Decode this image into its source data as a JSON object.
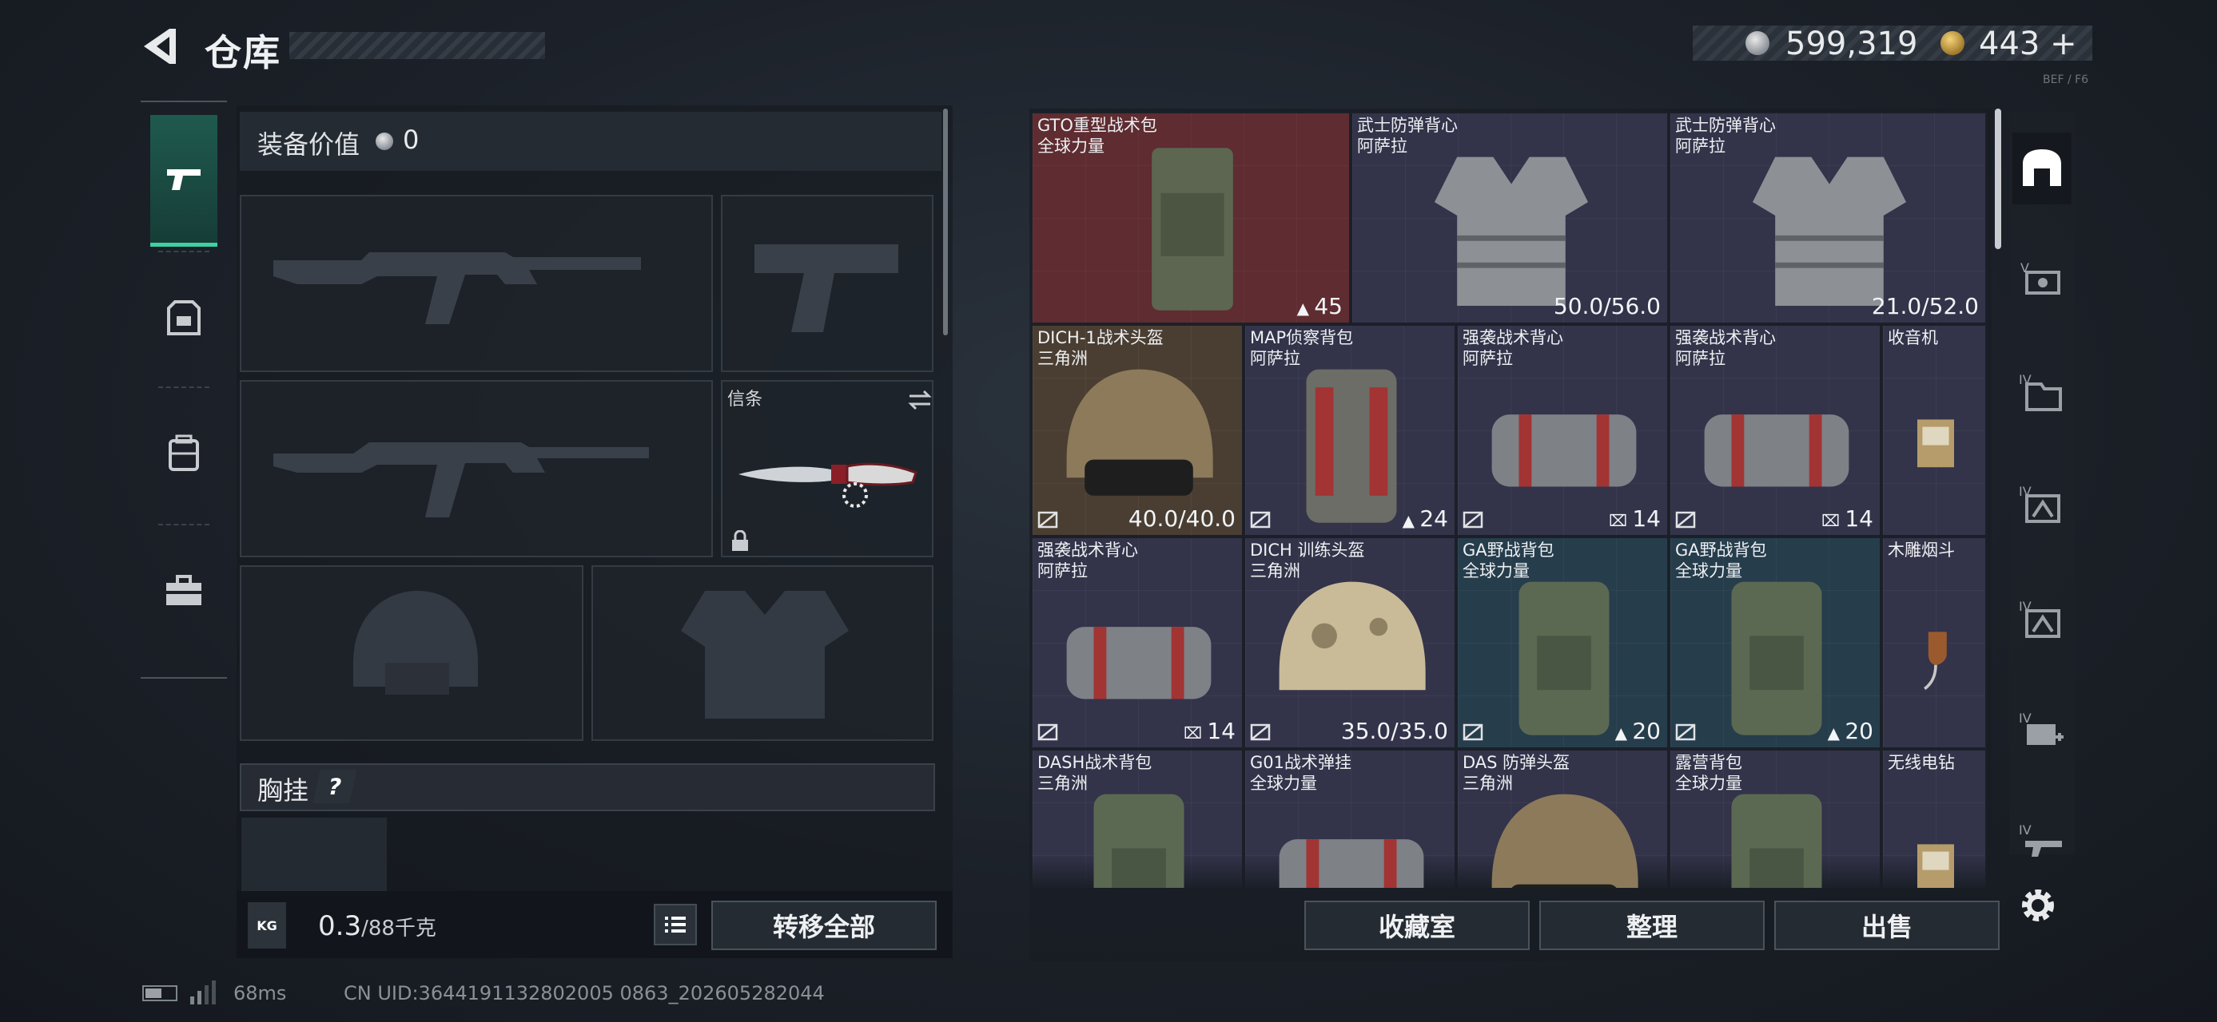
{
  "header": {
    "title": "仓库",
    "currency_silver": "599,319",
    "currency_gold": "443",
    "add_symbol": "+",
    "corner_label": "BEF / F6"
  },
  "loadout": {
    "equip_value_label": "装备价值",
    "equip_value": "0",
    "knife_label": "信条",
    "chest_label": "胸挂",
    "chest_help": "?",
    "weight_current": "0.3",
    "weight_max": "/88千克",
    "weight_icon_text": "KG",
    "transfer_all": "转移全部"
  },
  "left_rail": [
    "pistol-icon",
    "armor-icon",
    "backpack-icon",
    "toolbox-icon"
  ],
  "stash": {
    "items": [
      {
        "name": "GTO重型战术包",
        "sub": "全球力量",
        "stat": "45",
        "stat_icon": "bag",
        "rarity": "red"
      },
      {
        "name": "武士防弹背心",
        "sub": "阿萨拉",
        "stat": "50.0/56.0",
        "rarity": "purple"
      },
      {
        "name": "武士防弹背心",
        "sub": "阿萨拉",
        "stat": "21.0/52.0",
        "rarity": "purple"
      },
      {
        "name": "DICH-1战术头盔",
        "sub": "三角洲",
        "stat": "40.0/40.0",
        "rarity": "gold",
        "nobind": true
      },
      {
        "name": "MAP侦察背包",
        "sub": "阿萨拉",
        "stat": "24",
        "stat_icon": "bag",
        "rarity": "purple",
        "nobind": true
      },
      {
        "name": "强袭战术背心",
        "sub": "阿萨拉",
        "stat": "14",
        "stat_icon": "vest",
        "rarity": "purple",
        "nobind": true
      },
      {
        "name": "强袭战术背心",
        "sub": "阿萨拉",
        "stat": "14",
        "stat_icon": "vest",
        "rarity": "purple",
        "nobind": true
      },
      {
        "name": "收音机",
        "sub": "",
        "stat": "",
        "rarity": "purple"
      },
      {
        "name": "强袭战术背心",
        "sub": "阿萨拉",
        "stat": "14",
        "stat_icon": "vest",
        "rarity": "purple",
        "nobind": true
      },
      {
        "name": "DICH 训练头盔",
        "sub": "三角洲",
        "stat": "35.0/35.0",
        "rarity": "purple",
        "nobind": true
      },
      {
        "name": "GA野战背包",
        "sub": "全球力量",
        "stat": "20",
        "stat_icon": "bag",
        "rarity": "blue",
        "nobind": true
      },
      {
        "name": "GA野战背包",
        "sub": "全球力量",
        "stat": "20",
        "stat_icon": "bag",
        "rarity": "blue",
        "nobind": true
      },
      {
        "name": "木雕烟斗",
        "sub": "",
        "stat": "",
        "rarity": "purple"
      },
      {
        "name": "DASH战术背包",
        "sub": "三角洲",
        "stat": "",
        "rarity": "purple"
      },
      {
        "name": "G01战术弹挂",
        "sub": "全球力量",
        "stat": "",
        "rarity": "purple"
      },
      {
        "name": "DAS 防弹头盔",
        "sub": "三角洲",
        "stat": "",
        "rarity": "purple"
      },
      {
        "name": "露营背包",
        "sub": "全球力量",
        "stat": "",
        "rarity": "purple"
      },
      {
        "name": "无线电钻",
        "sub": "",
        "stat": "",
        "rarity": "purple"
      }
    ]
  },
  "filters": [
    "vault-icon",
    "tier-v-armor-icon",
    "tier-iv-folder-icon",
    "tier-iv-armor-icon",
    "tier-iv-armor-2-icon",
    "tier-iv-medkit-icon",
    "tier-iv-gun-icon"
  ],
  "actions": {
    "collection": "收藏室",
    "sort": "整理",
    "sell": "出售"
  },
  "status": {
    "ping": "68ms",
    "uid": "CN UID:3644191132802005 0863_202605282044"
  },
  "colors": {
    "accent": "#3fd0a4",
    "rarity_red": "#5e2c31",
    "rarity_gold": "#4a3e32",
    "rarity_blue": "#263d4c",
    "rarity_purple": "#33334a"
  }
}
